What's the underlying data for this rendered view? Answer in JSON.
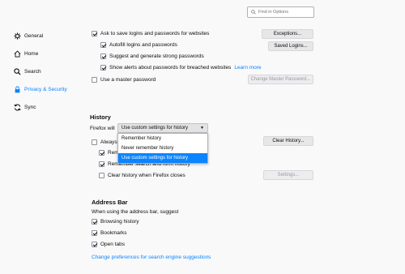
{
  "search": {
    "placeholder": "Find in Options"
  },
  "sidebar": {
    "items": [
      {
        "label": "General"
      },
      {
        "label": "Home"
      },
      {
        "label": "Search"
      },
      {
        "label": "Privacy & Security"
      },
      {
        "label": "Sync"
      }
    ]
  },
  "logins": {
    "ask_save": "Ask to save logins and passwords for websites",
    "autofill": "Autofill logins and passwords",
    "suggest": "Suggest and generate strong passwords",
    "breach_alerts": "Show alerts about passwords for breached websites",
    "learn_more": "Learn more",
    "master_password": "Use a master password",
    "exceptions_button": "Exceptions...",
    "saved_logins_button": "Saved Logins...",
    "change_master_button": "Change Master Password..."
  },
  "history": {
    "heading": "History",
    "firefox_will_label": "Firefox will",
    "selected": "Use custom settings for history",
    "options": [
      "Remember history",
      "Never remember history",
      "Use custom settings for history"
    ],
    "always_private_partial": "Always",
    "remember_browsing_partial": "Rem",
    "remember_search_partial": "Remember search and form history",
    "clear_on_close": "Clear history when Firefox closes",
    "clear_history_button": "Clear History...",
    "settings_button": "Settings..."
  },
  "address_bar": {
    "heading": "Address Bar",
    "subtitle": "When using the address bar, suggest",
    "browsing_history": "Browsing history",
    "bookmarks": "Bookmarks",
    "open_tabs": "Open tabs",
    "change_prefs_link": "Change preferences for search engine suggestions"
  },
  "colors": {
    "accent": "#0a84ff",
    "background": "#f9f9fa"
  }
}
